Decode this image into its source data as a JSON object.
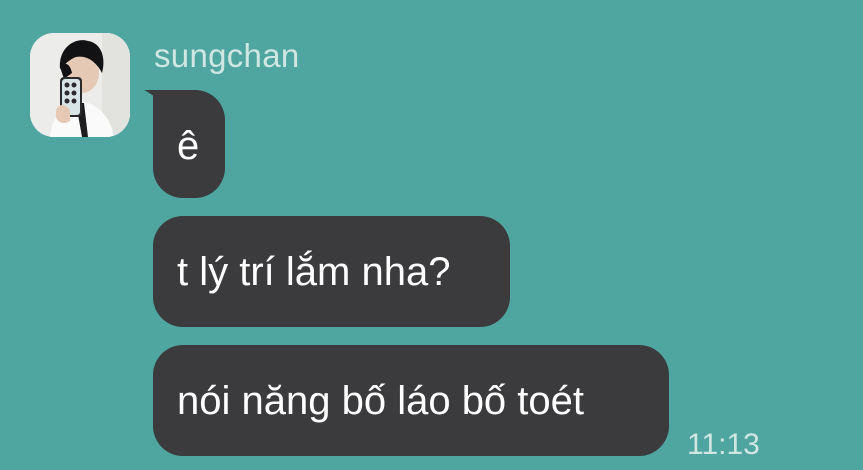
{
  "chat": {
    "sender_name": "sungchan",
    "messages": [
      {
        "text": "ê"
      },
      {
        "text": "t lý trí lắm nha?"
      },
      {
        "text": "nói năng bố láo bố toét"
      }
    ],
    "last_timestamp": "11:13"
  },
  "colors": {
    "background": "#4fa6a0",
    "bubble": "#3b3b3d",
    "bubble_text": "#ffffff",
    "meta_text": "#cfe6e3"
  }
}
